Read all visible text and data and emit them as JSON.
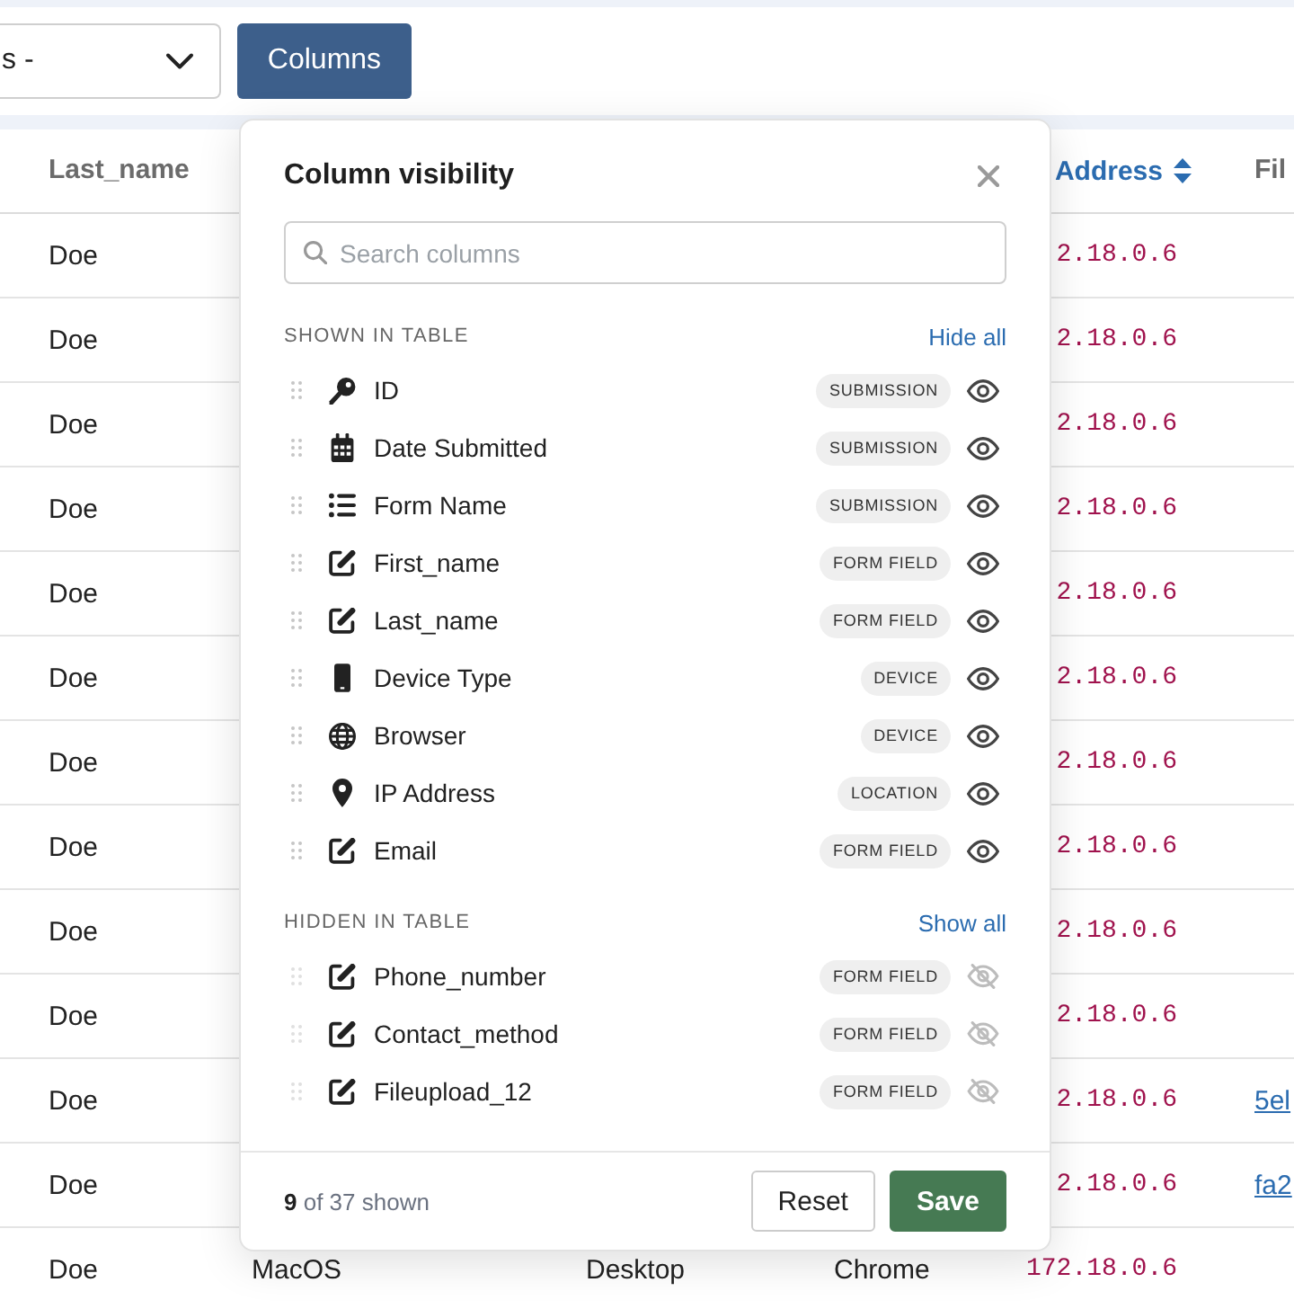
{
  "toolbar": {
    "filter_select": {
      "value": "s -"
    },
    "columns_button": {
      "label": "Columns"
    }
  },
  "table": {
    "header": {
      "last_name": {
        "label": "Last_name",
        "sorted": false
      },
      "address": {
        "label": "Address",
        "sorted": true
      },
      "column_6": {
        "label": "Fil",
        "sorted": false
      }
    },
    "rows": [
      {
        "last_name": "Doe",
        "address": "2.18.0.6"
      },
      {
        "last_name": "Doe",
        "address": "2.18.0.6"
      },
      {
        "last_name": "Doe",
        "address": "2.18.0.6"
      },
      {
        "last_name": "Doe",
        "address": "2.18.0.6"
      },
      {
        "last_name": "Doe",
        "address": "2.18.0.6"
      },
      {
        "last_name": "Doe",
        "address": "2.18.0.6"
      },
      {
        "last_name": "Doe",
        "address": "2.18.0.6"
      },
      {
        "last_name": "Doe",
        "address": "2.18.0.6"
      },
      {
        "last_name": "Doe",
        "address": "2.18.0.6"
      },
      {
        "last_name": "Doe",
        "address": "2.18.0.6"
      },
      {
        "last_name": "Doe",
        "address": "2.18.0.6",
        "column_6": "5el"
      },
      {
        "last_name": "Doe",
        "address": "2.18.0.6",
        "column_6": "fa2"
      },
      {
        "last_name": "Doe",
        "column_2": "MacOS",
        "column_3": "Desktop",
        "column_4": "Chrome",
        "address": "172.18.0.6"
      }
    ]
  },
  "column_panel": {
    "title": "Column visibility",
    "search": {
      "placeholder": "Search columns"
    },
    "sections": [
      {
        "heading": "SHOWN IN TABLE",
        "action": "Hide all",
        "items": [
          {
            "label": "ID",
            "kind": "id",
            "category": "SUBMISSION",
            "visible": true
          },
          {
            "label": "Date Submitted",
            "kind": "date",
            "category": "SUBMISSION",
            "visible": true
          },
          {
            "label": "Form Name",
            "kind": "name",
            "category": "SUBMISSION",
            "visible": true
          },
          {
            "label": "First_name",
            "kind": "field",
            "category": "FORM FIELD",
            "visible": true
          },
          {
            "label": "Last_name",
            "kind": "field",
            "category": "FORM FIELD",
            "visible": true
          },
          {
            "label": "Device Type",
            "kind": "device",
            "category": "DEVICE",
            "visible": true
          },
          {
            "label": "Browser",
            "kind": "browser",
            "category": "DEVICE",
            "visible": true
          },
          {
            "label": "IP Address",
            "kind": "location",
            "category": "LOCATION",
            "visible": true
          },
          {
            "label": "Email",
            "kind": "field",
            "category": "FORM FIELD",
            "visible": true
          }
        ]
      },
      {
        "heading": "HIDDEN IN TABLE",
        "action": "Show all",
        "items": [
          {
            "label": "Phone_number",
            "kind": "field",
            "category": "FORM FIELD",
            "visible": false
          },
          {
            "label": "Contact_method",
            "kind": "field",
            "category": "FORM FIELD",
            "visible": false
          },
          {
            "label": "Fileupload_12",
            "kind": "field",
            "category": "FORM FIELD",
            "visible": false
          }
        ]
      }
    ],
    "summary": "**9** of 37 shown",
    "buttons": [
      {
        "label": "Reset",
        "kind": "secondary"
      },
      {
        "label": "Save",
        "kind": "primary"
      }
    ]
  }
}
